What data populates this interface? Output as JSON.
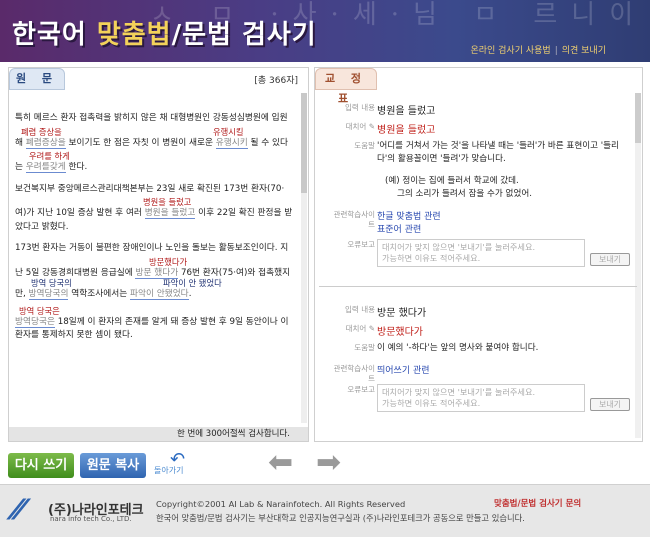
{
  "header": {
    "title_a": "한국어 ",
    "title_b": "맞춤법",
    "title_c": "/문법 검사기",
    "bg_glyphs": "ㅅ ㅁ ·사·세·님 ㅁ 르니이ㅅ 〈 上",
    "guide_link": "온라인 검사기 사용법",
    "separator": "|",
    "feedback_link": "의견 보내기"
  },
  "left": {
    "tab": "원 문",
    "count": "[총 366자]",
    "p1": {
      "l1": "특히 메르스 환자 접촉력을 밝히지 않은 채 대형병원인 강동성심병원에 입원",
      "ann1": "폐렴 증상을",
      "ann2": "유행시킬",
      "l2a": "해 ",
      "l2err1": "폐렴증상을",
      "l2b": " 보이기도 한 점은 자칫 이 병원이 새로운 ",
      "l2err2": "유행시키",
      "l2c": " 될 수 있다",
      "ann3": "우려를 하게",
      "l3a": "는 ",
      "l3err": "우려를갖게",
      "l3b": " 한다."
    },
    "p2": {
      "l1": "보건복지부 중앙메르스관리대책본부는 23일 새로 확진된 173번 환자(70·",
      "ann1": "병원을 들렀고",
      "l2a": "여)가 지난 10일 증상 발현 후 여러 ",
      "l2err": "병원을 들렀고",
      "l2b": " 이후 22일 확진 판정을 받",
      "l3": "았다고 밝혔다."
    },
    "p3": {
      "l1": "173번 환자는 거동이 불편한 장애인이나 노인을 돌보는 활동보조인이다. 지",
      "ann1": "방문했다가",
      "l2a": "난 5일 강동경희대병원 응급실에 ",
      "l2err": "방문 했다가",
      "l2b": " 76번 환자(75·여)와 접촉했지",
      "ann2": "방역 당국의",
      "ann3": "파악이 안 됐었다",
      "l3a": "만, ",
      "l3err1": "방역당국의",
      "l3b": " 역학조사에서는 ",
      "l3err2": "파악이 안됐었다",
      "l3c": "."
    },
    "p4": {
      "ann1": "방역 당국은",
      "l1err": "방역당국은",
      "l1b": " 18일께 이 환자의 존재를 알게 돼 증상 발현 후 9일 동안이나 이",
      "l2": "환자를 통제하지 못한 셈이 됐다."
    },
    "limit": "한 번에 300어절씩 검사합니다."
  },
  "right": {
    "tab": "교 정 표",
    "entry1": {
      "input_label": "입력 내용",
      "input": "병원을 들렀고",
      "replace_label": "대치어",
      "replace": "병원을 들렀고",
      "help_label": "도움말",
      "help1": "'어디를 거쳐서 가는 것'을 나타낼 때는 '들러'가 바른 표현이고 '들리",
      "help2": "다'의 활용꼴이면 '들려'가 맞습니다.",
      "ex1": "(예) 정이는 집에 들러서 학교에 갔데.",
      "ex2": "그의 소리가 들려서 잠을 수가 없었어.",
      "related_label": "관련학습사이트",
      "related1": "한글 맞춤법 관련",
      "related2": "표준어 관련",
      "report_label": "오류보고",
      "report_ph1": "대치어가 맞지 않으면 '보내기'를 눌러주세요.",
      "report_ph2": "가능하면 이유도 적어주세요.",
      "send": "보내기"
    },
    "entry2": {
      "input_label": "입력 내용",
      "input": "방문 했다가",
      "replace_label": "대치어",
      "replace": "방문했다가",
      "help_label": "도움말",
      "help1": "이 예의 '-하다'는 앞의 명사와 붙여야 합니다.",
      "related_label": "관련학습사이트",
      "related1": "띄어쓰기 관련",
      "report_label": "오류보고",
      "report_ph1": "대치어가 맞지 않으면 '보내기'를 눌러주세요.",
      "report_ph2": "가능하면 이유도 적어주세요.",
      "send": "보내기"
    }
  },
  "buttons": {
    "rewrite": "다시 쓰기",
    "copy": "원문 복사",
    "back": "돌아가기"
  },
  "footer": {
    "logo_name": "(주)나라인포테크",
    "logo_sub": "nara info tech Co., LTD.",
    "copyright": "Copyright©2001 AI Lab & Narainfotech. All Rights Reserved",
    "desc": "한국어 맞춤법/문법 검사기는 부산대학교 인공지능연구실과 (주)나라인포테크가 공동으로 만들고 있습니다.",
    "inquiry": "맞춤법/문법 검사기 문의"
  },
  "colors": {
    "header_bg": "#3b4a8c",
    "accent": "#f3d25a",
    "error_red": "#c0201a",
    "link_blue": "#2a4ab0"
  }
}
